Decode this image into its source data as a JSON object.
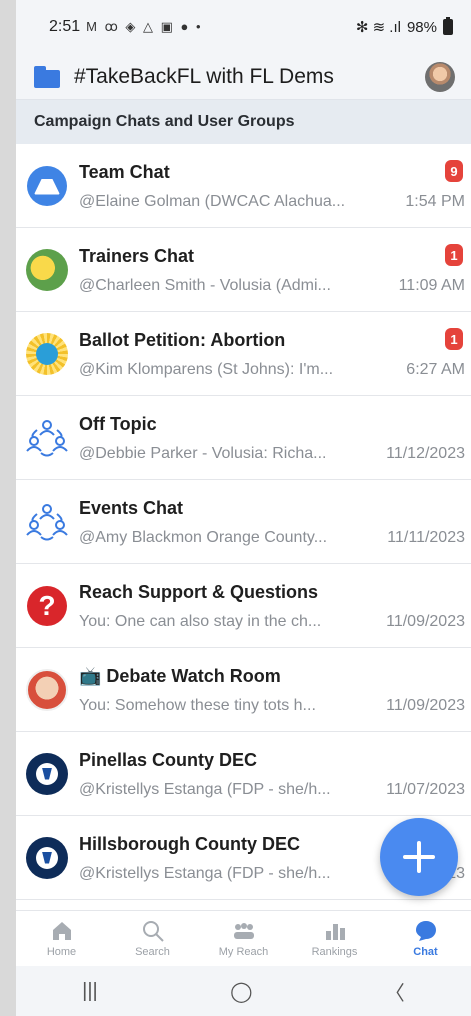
{
  "status_bar": {
    "time": "2:51",
    "notification_icons": "M ꝏ ◈ △ ▣ ● •",
    "right_icons": "✻ ≋ .ıl",
    "battery": "98%"
  },
  "header": {
    "title": "#TakeBackFL with FL Dems"
  },
  "section": {
    "title": "Campaign Chats and User Groups"
  },
  "chats": [
    {
      "title": "Team Chat",
      "preview": "@Elaine Golman (DWCAC Alachua...",
      "time": "1:54 PM",
      "badge": "9",
      "icon": "team-chat-icon"
    },
    {
      "title": "Trainers Chat",
      "preview": "@Charleen Smith - Volusia (Admi...",
      "time": "11:09 AM",
      "badge": "1",
      "icon": "pikachu-avatar-icon"
    },
    {
      "title": "Ballot Petition: Abortion",
      "preview": "@Kim Klomparens (St Johns): I'm...",
      "time": "6:27 AM",
      "badge": "1",
      "icon": "florida-sun-icon"
    },
    {
      "title": "Off Topic",
      "preview": "@Debbie Parker  - Volusia: Richa...",
      "time": "11/12/2023",
      "badge": "",
      "icon": "group-icon"
    },
    {
      "title": "Events Chat",
      "preview": "@Amy Blackmon Orange County...",
      "time": "11/11/2023",
      "badge": "",
      "icon": "group-icon"
    },
    {
      "title": "Reach Support & Questions",
      "preview": "You: One can also stay in the ch...",
      "time": "11/09/2023",
      "badge": "",
      "icon": "question-icon"
    },
    {
      "title": "📺 Debate Watch Room",
      "preview": "You: Somehow these tiny tots h...",
      "time": "11/09/2023",
      "badge": "",
      "icon": "debate-avatar-icon"
    },
    {
      "title": "Pinellas County DEC",
      "preview": "@Kristellys Estanga (FDP - she/h...",
      "time": "11/07/2023",
      "badge": "",
      "icon": "dec-logo-icon"
    },
    {
      "title": "Hillsborough County DEC",
      "preview": "@Kristellys Estanga (FDP - she/h...",
      "time": "11/07/2023",
      "badge": "",
      "icon": "dec-logo-icon"
    }
  ],
  "bottom_nav": [
    {
      "label": "Home",
      "active": false
    },
    {
      "label": "Search",
      "active": false
    },
    {
      "label": "My Reach",
      "active": false
    },
    {
      "label": "Rankings",
      "active": false
    },
    {
      "label": "Chat",
      "active": true
    }
  ],
  "system_nav": {
    "recents": "|||",
    "home": "◯",
    "back": "〈"
  },
  "colors": {
    "accent": "#3a7ae0",
    "badge": "#e5433b",
    "fab": "#4a8af0"
  }
}
